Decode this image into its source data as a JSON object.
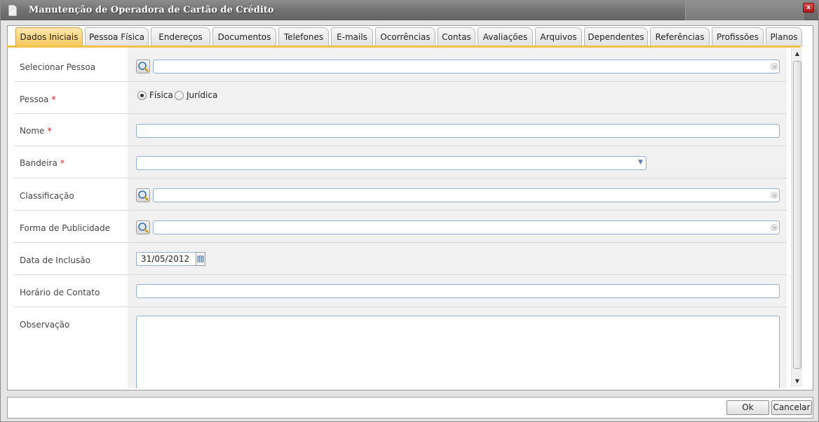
{
  "window": {
    "title": "Manutenção de Operadora de Cartão de Crédito",
    "close_label": "x"
  },
  "tabs": [
    {
      "label": "Dados Iniciais",
      "active": true
    },
    {
      "label": "Pessoa Física"
    },
    {
      "label": "Endereços"
    },
    {
      "label": "Documentos"
    },
    {
      "label": "Telefones"
    },
    {
      "label": "E-mails"
    },
    {
      "label": "Ocorrências"
    },
    {
      "label": "Contas"
    },
    {
      "label": "Avaliações"
    },
    {
      "label": "Arquivos"
    },
    {
      "label": "Dependentes"
    },
    {
      "label": "Referências"
    },
    {
      "label": "Profissões"
    },
    {
      "label": "Planos"
    }
  ],
  "form": {
    "selecionar_pessoa": {
      "label": "Selecionar Pessoa",
      "value": ""
    },
    "pessoa": {
      "label": "Pessoa",
      "required_mark": "*",
      "options": [
        {
          "label": "Física",
          "checked": true
        },
        {
          "label": "Jurídica",
          "checked": false
        }
      ]
    },
    "nome": {
      "label": "Nome",
      "required_mark": "*",
      "value": ""
    },
    "bandeira": {
      "label": "Bandeira",
      "required_mark": "*",
      "value": ""
    },
    "classificacao": {
      "label": "Classificação",
      "value": ""
    },
    "forma_publicidade": {
      "label": "Forma de Publicidade",
      "value": ""
    },
    "data_inclusao": {
      "label": "Data de Inclusão",
      "value": "31/05/2012"
    },
    "horario_contato": {
      "label": "Horário de Contato",
      "value": ""
    },
    "observacao": {
      "label": "Observação",
      "value": ""
    }
  },
  "footer": {
    "ok_label": "Ok",
    "cancel_label": "Cancelar"
  },
  "colors": {
    "active_tab": "#f7c85a",
    "required": "#e02020",
    "titlebar": "#6e6e6e"
  }
}
